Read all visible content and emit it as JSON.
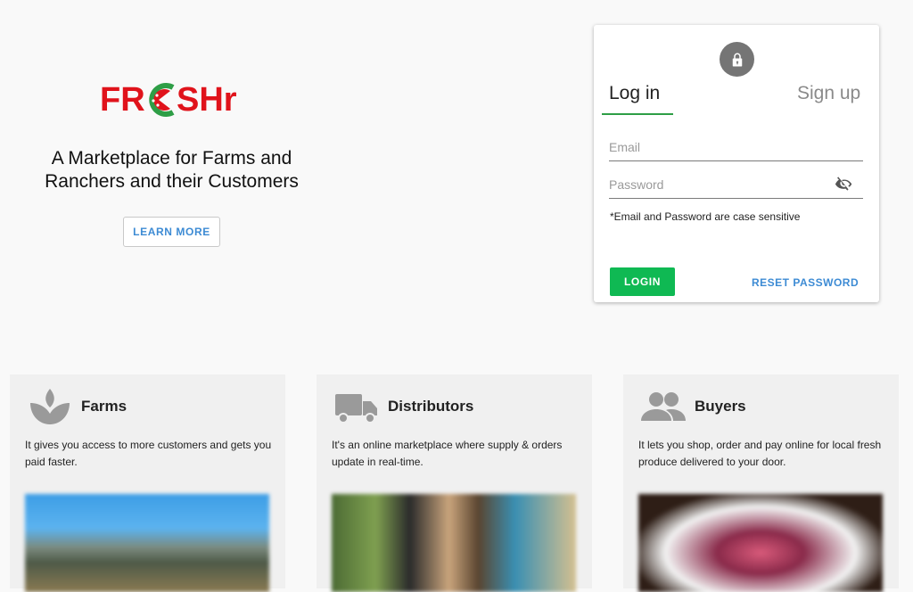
{
  "brand": {
    "logo_text": "FRESHr",
    "tagline": "A Marketplace for Farms and Ranchers and their Customers",
    "learn_more": "LEARN MORE",
    "logo_colors": {
      "red": "#e0131b",
      "green": "#2e9e46"
    }
  },
  "auth": {
    "tabs": {
      "login": "Log in",
      "signup": "Sign up"
    },
    "email_placeholder": "Email",
    "password_placeholder": "Password",
    "note": "*Email and Password are case sensitive",
    "login_button": "LOGIN",
    "reset_link": "RESET PASSWORD",
    "accent": "#0fb953"
  },
  "features": [
    {
      "icon": "sprout-icon",
      "title": "Farms",
      "description": "It gives you access to more customers and gets you paid faster."
    },
    {
      "icon": "truck-icon",
      "title": "Distributors",
      "description": "It's an online marketplace where supply & orders update in real-time."
    },
    {
      "icon": "people-icon",
      "title": "Buyers",
      "description": "It lets you shop, order and pay online for local fresh produce delivered to your door."
    }
  ]
}
